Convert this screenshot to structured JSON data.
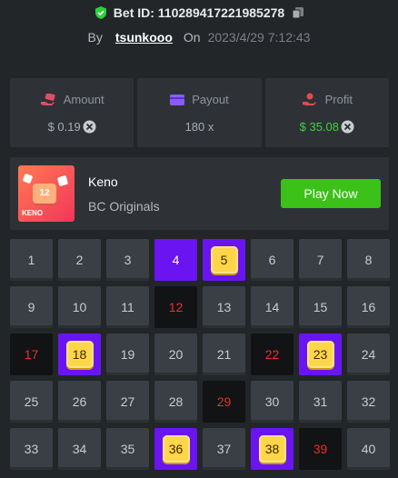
{
  "header": {
    "bet_id_label": "Bet ID: 110289417221985278",
    "by_label": "By",
    "username": "tsunkooo",
    "on_label": "On",
    "datetime": "2023/4/29 7:12:43"
  },
  "stats": [
    {
      "label": "Amount",
      "value": "$ 0.19",
      "icon": "coin-hand-icon",
      "color": "#e34b6a"
    },
    {
      "label": "Payout",
      "value": "180 x",
      "icon": "wallet-icon",
      "color": "#8a5cf6"
    },
    {
      "label": "Profit",
      "value": "$ 35.08",
      "icon": "profit-hand-icon",
      "color": "#e34b4b"
    }
  ],
  "game": {
    "name": "Keno",
    "provider": "BC Originals",
    "thumb_number": "12",
    "thumb_title": "KENO",
    "play_label": "Play Now"
  },
  "colors": {
    "picked": "#6b14f2",
    "hit_gem": "#ffd54a",
    "drawn_miss": "#e8302c",
    "play_button": "#3bc117",
    "profit": "#3fd13f"
  },
  "board": {
    "numbers": [
      1,
      2,
      3,
      4,
      5,
      6,
      7,
      8,
      9,
      10,
      11,
      12,
      13,
      14,
      15,
      16,
      17,
      18,
      19,
      20,
      21,
      22,
      23,
      24,
      25,
      26,
      27,
      28,
      29,
      30,
      31,
      32,
      33,
      34,
      35,
      36,
      37,
      38,
      39,
      40
    ],
    "picked_only": [
      4
    ],
    "hits": [
      5,
      18,
      23,
      36,
      38
    ],
    "drawn_misses": [
      12,
      17,
      22,
      29,
      39
    ]
  }
}
